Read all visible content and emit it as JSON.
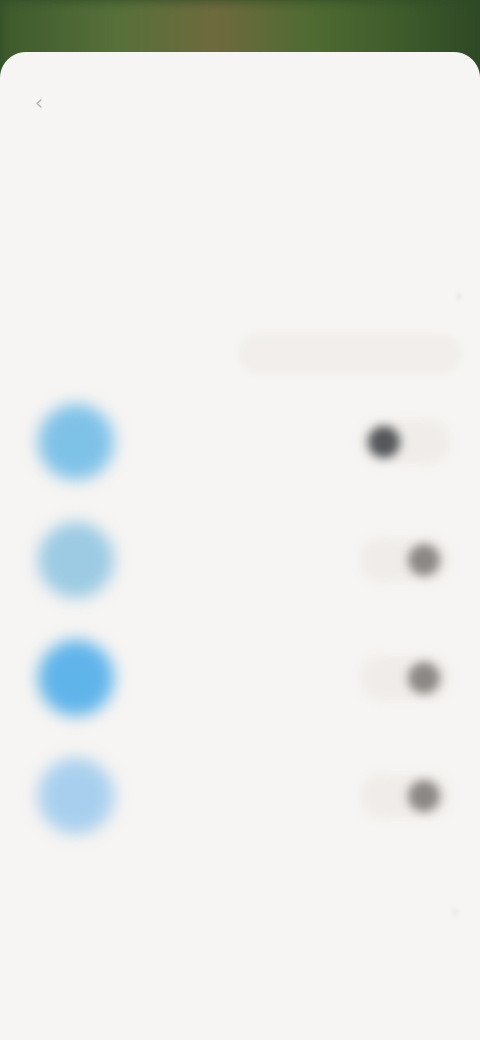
{
  "header": {
    "back_icon": "chevron-left-icon",
    "title": "",
    "right_action": ""
  },
  "tabs": [
    {
      "label": ""
    },
    {
      "label": ""
    },
    {
      "label": ""
    },
    {
      "label": ""
    }
  ],
  "section": {
    "title": "",
    "sub_left": "",
    "sub_pill": ""
  },
  "apps": [
    {
      "label": "",
      "toggle": "on",
      "icon_color": "#7fc2e8"
    },
    {
      "label": "",
      "toggle": "off",
      "icon_color": "#9ccbe3"
    },
    {
      "label": "",
      "toggle": "off",
      "icon_color": "#5fb4ea"
    },
    {
      "label": "",
      "toggle": "off",
      "icon_color": "#a8d0ee"
    }
  ],
  "footer": {
    "title": "",
    "link": ""
  },
  "colors": {
    "sheet_background": "#f7f5f3",
    "toggle_on_knob": "#55575a",
    "toggle_off_knob": "#8b8885"
  }
}
